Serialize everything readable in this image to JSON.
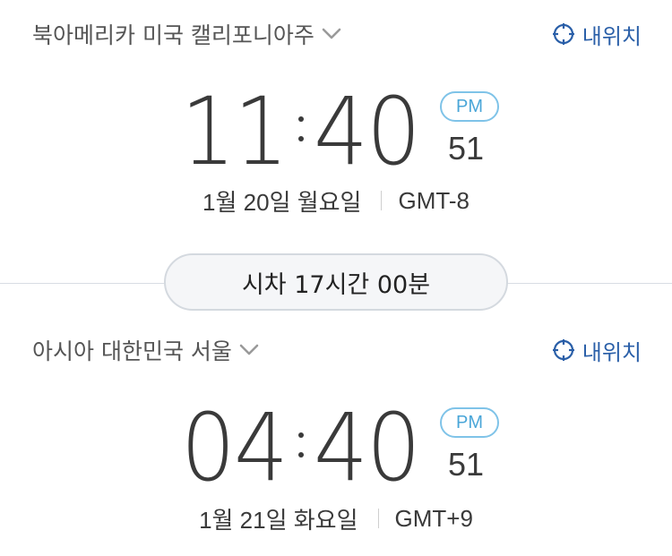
{
  "top": {
    "location": "북아메리카 미국 캘리포니아주",
    "my_location_label": "내위치",
    "hour": "11",
    "minute": "40",
    "ampm": "PM",
    "seconds": "51",
    "date": "1월 20일 월요일",
    "gmt": "GMT-8"
  },
  "difference": {
    "label": "시차 17시간 00분"
  },
  "bottom": {
    "location": "아시아 대한민국 서울",
    "my_location_label": "내위치",
    "hour": "04",
    "minute": "40",
    "ampm": "PM",
    "seconds": "51",
    "date": "1월 21일 화요일",
    "gmt": "GMT+9"
  },
  "colors": {
    "accent_blue": "#2a5fa8",
    "ampm_blue": "#4aa6d8",
    "text_dark": "#3a3a3a",
    "text_gray": "#555555"
  },
  "icons": [
    "chevron-down-icon",
    "crosshair-target-icon"
  ]
}
